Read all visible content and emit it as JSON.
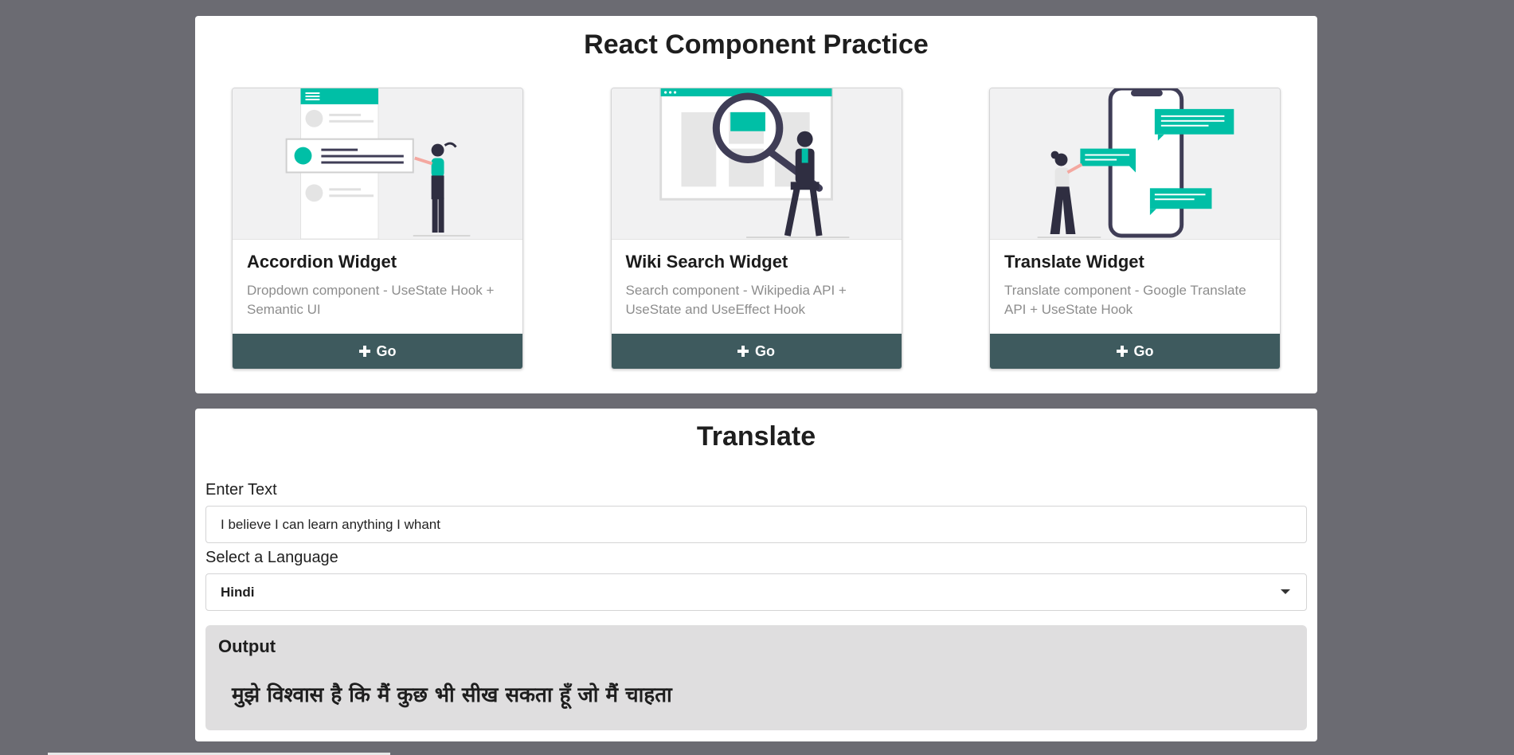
{
  "practice": {
    "title": "React Component Practice",
    "cards": [
      {
        "header": "Accordion Widget",
        "description": "Dropdown component - UseState Hook + Semantic UI",
        "button_label": "Go",
        "button_icon": "plus-icon",
        "illustration": "accordion-illustration"
      },
      {
        "header": "Wiki Search Widget",
        "description": "Search component - Wikipedia API + UseState and UseEffect Hook",
        "button_label": "Go",
        "button_icon": "plus-icon",
        "illustration": "search-illustration"
      },
      {
        "header": "Translate Widget",
        "description": "Translate component - Google Translate API + UseState Hook",
        "button_label": "Go",
        "button_icon": "plus-icon",
        "illustration": "chat-illustration"
      }
    ]
  },
  "translate": {
    "title": "Translate",
    "text_label": "Enter Text",
    "text_value": "I believe I can learn anything I whant",
    "language_label": "Select a Language",
    "language_selected": "Hindi",
    "output_title": "Output",
    "output_text": "मुझे विश्वास है कि मैं कुछ भी सीख सकता हूँ जो मैं चाहता"
  },
  "colors": {
    "background": "#6b6b72",
    "button": "#3e5a5e",
    "accent": "#00bfa6",
    "output_bg": "#dfdedf"
  }
}
